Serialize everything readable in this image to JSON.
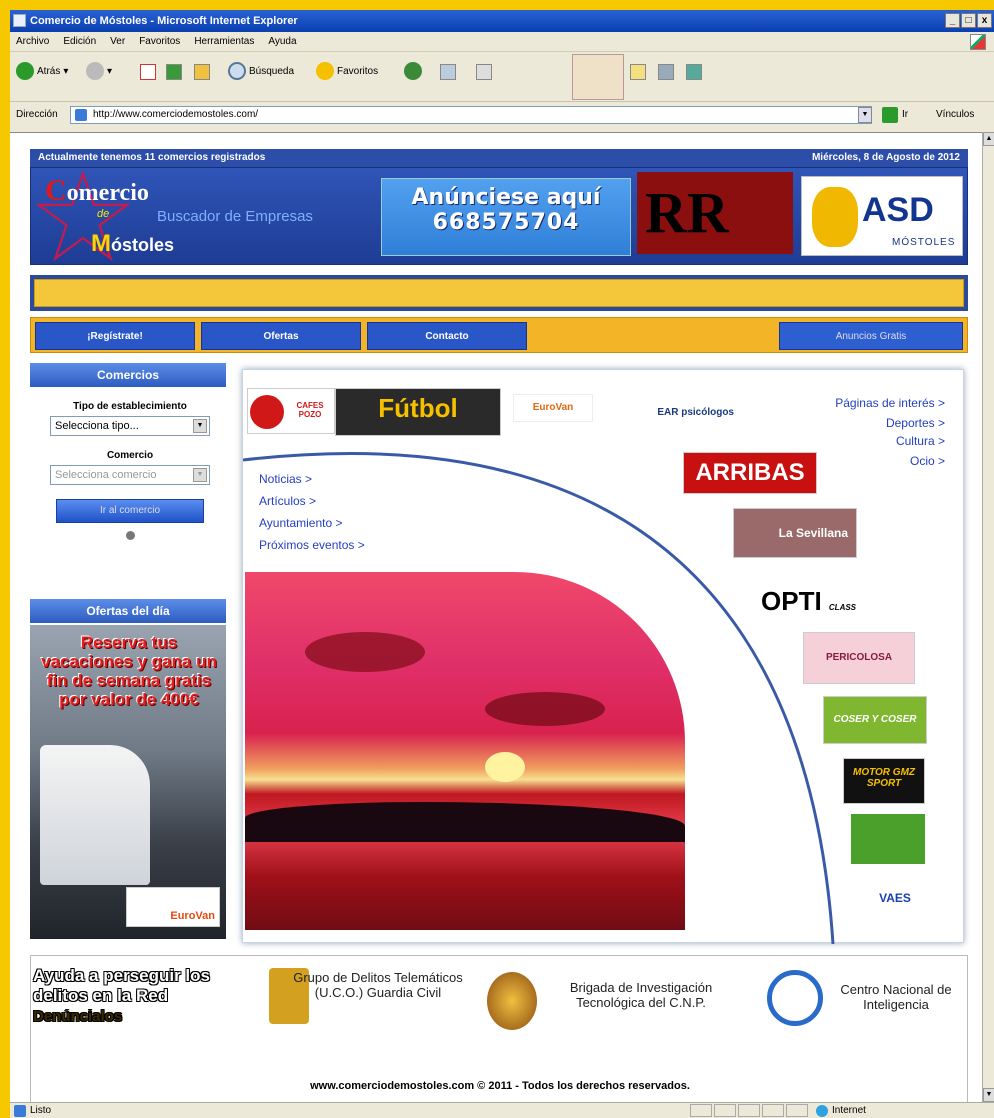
{
  "window": {
    "title": "Comercio de Móstoles - Microsoft Internet Explorer",
    "min": "_",
    "max": "□",
    "close": "x"
  },
  "menu": [
    "Archivo",
    "Edición",
    "Ver",
    "Favoritos",
    "Herramientas",
    "Ayuda"
  ],
  "toolbar": {
    "back": "Atrás",
    "search": "Búsqueda",
    "favorites": "Favoritos"
  },
  "address": {
    "label": "Dirección",
    "url": "http://www.comerciodemostoles.com/",
    "go": "Ir",
    "links": "Vínculos"
  },
  "status": {
    "left": "Listo",
    "right": "Internet"
  },
  "site": {
    "top_left": "Actualmente tenemos 11 comercios registrados",
    "top_right": "Miércoles, 8 de Agosto de 2012",
    "logo": {
      "line1_initial": "C",
      "line1_rest": "omercio",
      "de": "de",
      "subtitle": "Buscador de Empresas",
      "line3_initial": "M",
      "line3_rest": "óstoles"
    },
    "banner": {
      "line1": "Anúnciese aquí",
      "line2": "668575704"
    },
    "rr": "RR",
    "asd": {
      "title": "ASD",
      "city": "MÓSTOLES"
    },
    "nav": [
      "¡Regístrate!",
      "Ofertas",
      "Contacto",
      "Anuncios Gratis"
    ],
    "sidebar": {
      "title": "Comercios",
      "type_label": "Tipo de establecimiento",
      "type_select": "Selecciona tipo...",
      "shop_label": "Comercio",
      "shop_select": "Selecciona comercio",
      "go_button": "Ir al comercio",
      "offers_title": "Ofertas del día",
      "offer_text": "Reserva tus vacaciones y gana un fin de semana gratis por valor de 400€",
      "offer_brand": "EuroVan"
    },
    "links_left": [
      "Noticias >",
      "Artículos >",
      "Ayuntamiento >",
      "Próximos eventos >"
    ],
    "links_right": [
      "Páginas de interés >",
      "Deportes >",
      "Cultura >",
      "Ocio >"
    ],
    "ads": {
      "cafes": "CAFES POZO",
      "futbol": "Fútbol",
      "eurovan": "EuroVan",
      "ear": "EAR psicólogos",
      "arribas": "ARRIBAS",
      "sevillana": "La Sevillana",
      "opti": "OPTI",
      "opti_class": "CLASS",
      "pericolosa": "PERICOLOSA",
      "coser": "COSER Y COSER",
      "motor": "MOTOR GMZ SPORT",
      "vaes": "VAES"
    },
    "footer": {
      "ayuda": "Ayuda a perseguir los delitos en la Red",
      "denuncia": "Denúncialos",
      "uco": "Grupo de Delitos Telemáticos (U.C.O.) Guardia Civil",
      "cnp": "Brigada de Investigación Tecnológica del C.N.P.",
      "cni": "Centro Nacional de Inteligencia",
      "copyright": "www.comerciodemostoles.com © 2011 - Todos los derechos reservados."
    }
  }
}
